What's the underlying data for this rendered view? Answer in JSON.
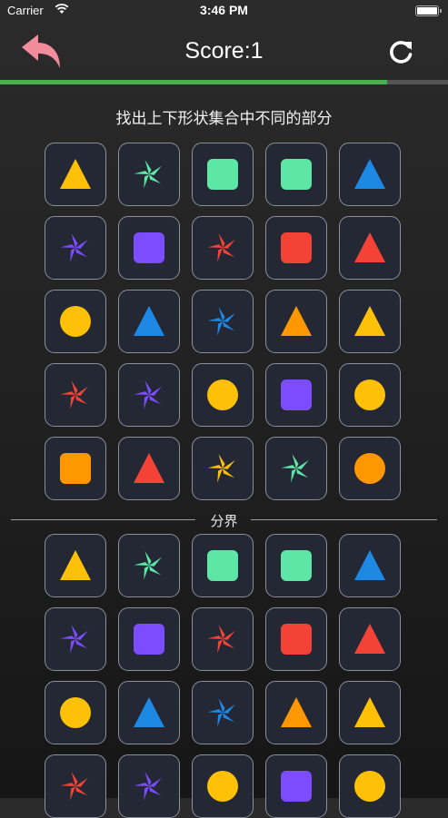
{
  "status_bar": {
    "carrier": "Carrier",
    "time": "3:46 PM"
  },
  "header": {
    "score_text": "Score:1",
    "back_icon": "back-arrow-icon",
    "refresh_icon": "refresh-icon"
  },
  "progress": {
    "value": 0.865,
    "color": "#4cb050"
  },
  "instruction": "找出上下形状集合中不同的部分",
  "divider_label": "分界",
  "colors": {
    "yellow": "#ffc107",
    "teal": "#5de6a5",
    "blue": "#1e88e5",
    "purple": "#7c4dff",
    "red": "#f44336",
    "orange": "#ff9800"
  },
  "top_grid": [
    [
      "triangle",
      "yellow"
    ],
    [
      "pinwheel",
      "teal"
    ],
    [
      "square",
      "teal"
    ],
    [
      "square",
      "teal"
    ],
    [
      "triangle",
      "blue"
    ],
    [
      "pinwheel",
      "purple"
    ],
    [
      "square",
      "purple"
    ],
    [
      "pinwheel",
      "red"
    ],
    [
      "square",
      "red"
    ],
    [
      "triangle",
      "red"
    ],
    [
      "circle",
      "yellow"
    ],
    [
      "triangle",
      "blue"
    ],
    [
      "pinwheel",
      "blue"
    ],
    [
      "triangle",
      "orange"
    ],
    [
      "triangle",
      "yellow"
    ],
    [
      "pinwheel",
      "red"
    ],
    [
      "pinwheel",
      "purple"
    ],
    [
      "circle",
      "yellow"
    ],
    [
      "square",
      "purple"
    ],
    [
      "circle",
      "yellow"
    ],
    [
      "square",
      "orange"
    ],
    [
      "triangle",
      "red"
    ],
    [
      "pinwheel",
      "yellow"
    ],
    [
      "pinwheel",
      "teal"
    ],
    [
      "circle",
      "orange"
    ]
  ],
  "bottom_grid": [
    [
      "triangle",
      "yellow"
    ],
    [
      "pinwheel",
      "teal"
    ],
    [
      "square",
      "teal"
    ],
    [
      "square",
      "teal"
    ],
    [
      "triangle",
      "blue"
    ],
    [
      "pinwheel",
      "purple"
    ],
    [
      "square",
      "purple"
    ],
    [
      "pinwheel",
      "red"
    ],
    [
      "square",
      "red"
    ],
    [
      "triangle",
      "red"
    ],
    [
      "circle",
      "yellow"
    ],
    [
      "triangle",
      "blue"
    ],
    [
      "pinwheel",
      "blue"
    ],
    [
      "triangle",
      "orange"
    ],
    [
      "triangle",
      "yellow"
    ],
    [
      "pinwheel",
      "red"
    ],
    [
      "pinwheel",
      "purple"
    ],
    [
      "circle",
      "yellow"
    ],
    [
      "square",
      "purple"
    ],
    [
      "circle",
      "yellow"
    ]
  ]
}
